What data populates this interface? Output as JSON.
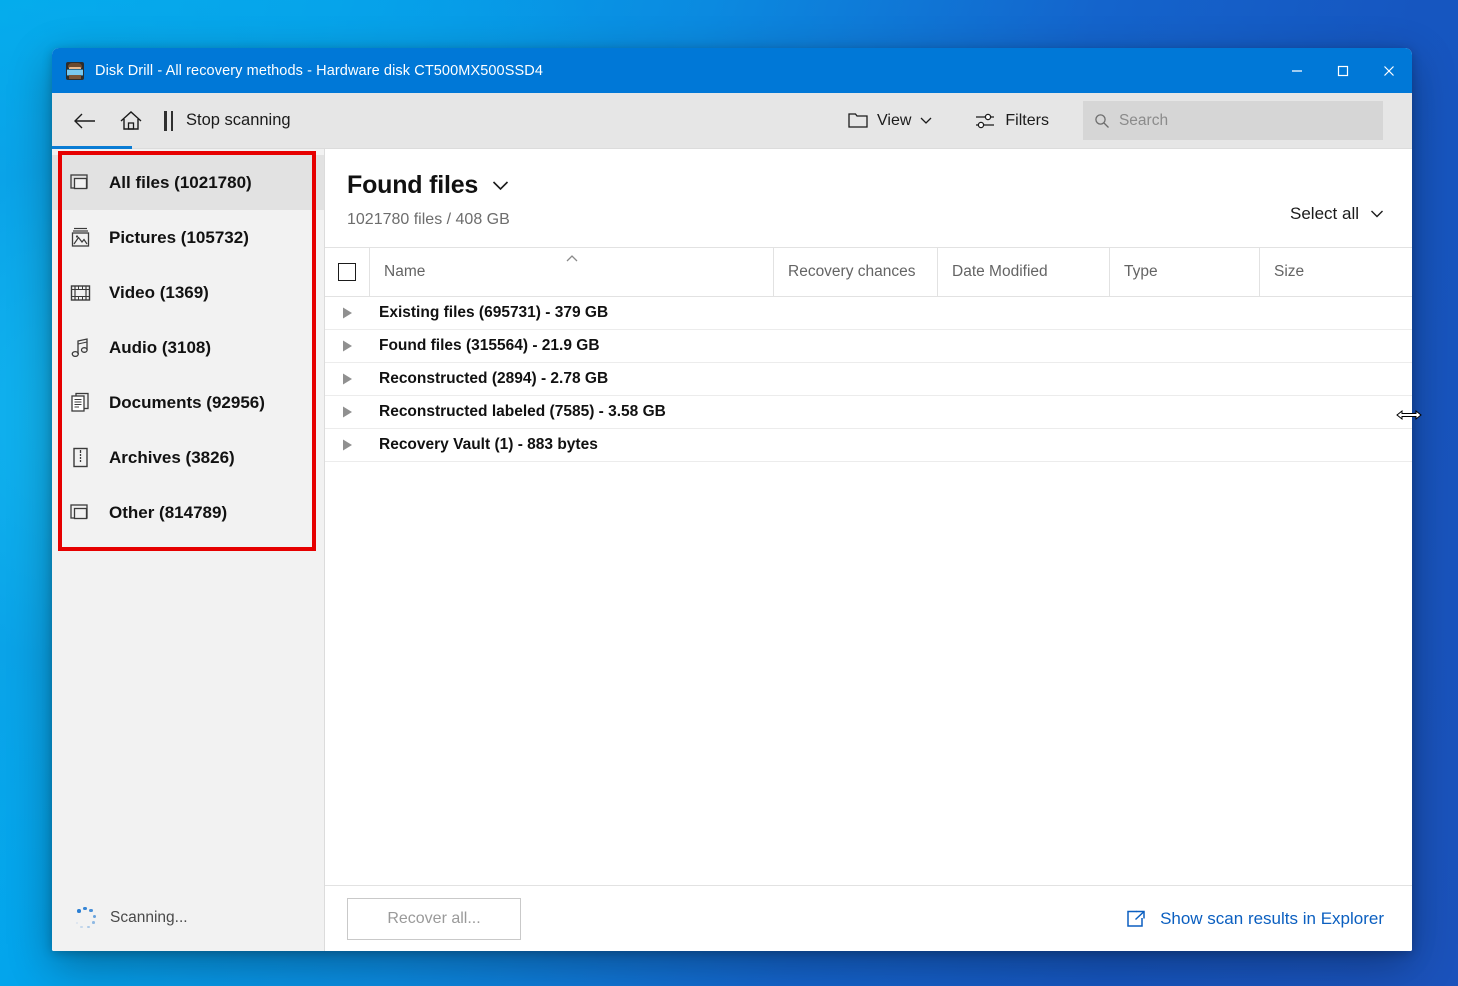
{
  "window": {
    "title": "Disk Drill - All recovery methods - Hardware disk CT500MX500SSD4",
    "app_icon": "disk-drill-avatar-icon",
    "minimize_label": "—",
    "maximize_label": "□",
    "close_label": "✕",
    "titlebar_color": "#0078d7"
  },
  "toolbar": {
    "back_icon": "back-arrow-icon",
    "home_icon": "home-icon",
    "pause_icon": "pause-icon",
    "stop_scanning_label": "Stop scanning",
    "view_label": "View",
    "view_icon": "folder-icon",
    "view_chevron": "chevron-down-icon",
    "filters_label": "Filters",
    "filters_icon": "sliders-icon",
    "search_icon": "search-icon",
    "search_placeholder": "Search",
    "search_value": "",
    "more_label": "•••",
    "accent_color": "#0a7cd4"
  },
  "sidebar": {
    "highlight_color": "#e60000",
    "items": [
      {
        "label": "All files (1021780)",
        "icon": "window-copy-icon",
        "selected": true
      },
      {
        "label": "Pictures (105732)",
        "icon": "picture-icon",
        "selected": false
      },
      {
        "label": "Video (1369)",
        "icon": "film-strip-icon",
        "selected": false
      },
      {
        "label": "Audio (3108)",
        "icon": "music-note-icon",
        "selected": false
      },
      {
        "label": "Documents (92956)",
        "icon": "documents-icon",
        "selected": false
      },
      {
        "label": "Archives (3826)",
        "icon": "zip-archive-icon",
        "selected": false
      },
      {
        "label": "Other (814789)",
        "icon": "window-copy-icon",
        "selected": false
      }
    ],
    "status": {
      "label": "Scanning...",
      "spinner_icon": "dots-spinner-icon",
      "spinner_color": "#2b7fd4"
    }
  },
  "main": {
    "title": "Found files",
    "title_chevron": "chevron-down-icon",
    "summary": "1021780 files / 408 GB",
    "select_all_label": "Select all",
    "select_all_chevron": "chevron-down-icon",
    "table": {
      "header_checkbox": "select-all-checkbox",
      "sort_indicator": "sort-ascending-caret-icon",
      "columns": [
        "Name",
        "Recovery chances",
        "Date Modified",
        "Type",
        "Size"
      ],
      "rows": [
        {
          "label": "Existing files (695731) - 379 GB",
          "expander": "expand-caret-icon"
        },
        {
          "label": "Found files (315564) - 21.9 GB",
          "expander": "expand-caret-icon"
        },
        {
          "label": "Reconstructed (2894) - 2.78 GB",
          "expander": "expand-caret-icon"
        },
        {
          "label": "Reconstructed labeled (7585) - 3.58 GB",
          "expander": "expand-caret-icon"
        },
        {
          "label": "Recovery Vault (1) - 883 bytes",
          "expander": "expand-caret-icon"
        }
      ]
    }
  },
  "footer": {
    "recover_all_label": "Recover all...",
    "show_explorer_label": "Show scan results in Explorer",
    "show_explorer_icon": "open-external-icon",
    "link_color": "#0b5fc0"
  },
  "cursor": {
    "type": "horizontal-resize-cursor"
  }
}
